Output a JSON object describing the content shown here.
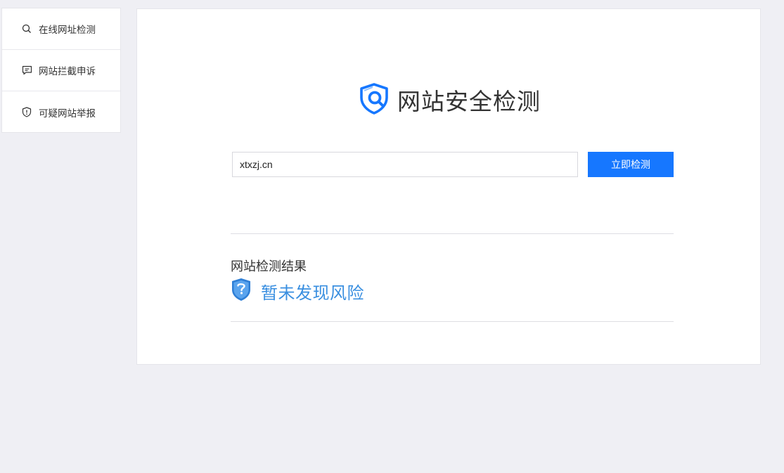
{
  "sidebar": {
    "items": [
      {
        "label": "在线网址检测",
        "icon": "search-icon"
      },
      {
        "label": "网站拦截申诉",
        "icon": "message-icon"
      },
      {
        "label": "可疑网站举报",
        "icon": "shield-alert-icon"
      }
    ]
  },
  "main": {
    "title": "网站安全检测",
    "logo_icon": "shield-search-icon",
    "search": {
      "value": "xtxzj.cn",
      "button_label": "立即检测"
    },
    "result": {
      "heading": "网站检测结果",
      "status_text": "暂未发现风险",
      "status_icon": "shield-question-icon",
      "status_color": "#3a8fe0"
    }
  },
  "colors": {
    "accent": "#1677ff",
    "background": "#efeff4"
  }
}
